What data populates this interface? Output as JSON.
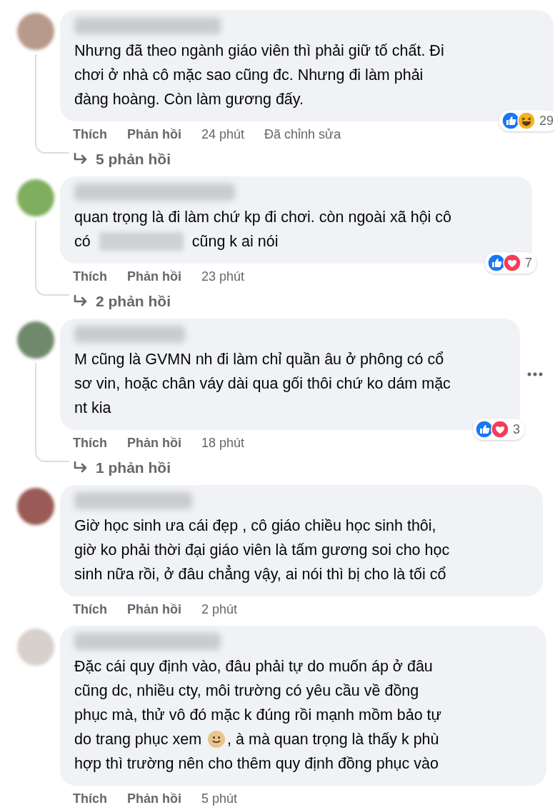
{
  "comments": [
    {
      "lines": [
        [
          {
            "kind": "text",
            "text": "Nhưng đã theo ngành giáo viên thì phải giữ tố chất. Đi"
          }
        ],
        [
          {
            "kind": "text",
            "text": "chơi ở nhà cô mặc sao cũng đc. Nhưng đi làm phải"
          }
        ],
        [
          {
            "kind": "text",
            "text": "đàng hoàng. Còn làm gương đấy."
          }
        ]
      ],
      "reactions": [
        {
          "kind": "like"
        },
        {
          "kind": "haha"
        }
      ],
      "reaction_count": "29",
      "actions": [
        "Thích",
        "Phản hồi"
      ],
      "time": "24 phút",
      "edited": "Đã chỉnh sửa",
      "replies": "5 phản hồi",
      "menu": false
    },
    {
      "lines": [
        [
          {
            "kind": "text",
            "text": "quan trọng là đi làm chứ kp đi chơi. còn ngoài xã hội cô"
          }
        ],
        [
          {
            "kind": "text",
            "text": "có"
          },
          {
            "kind": "blur"
          },
          {
            "kind": "text",
            "text": "cũng k ai nói"
          }
        ]
      ],
      "reactions": [
        {
          "kind": "like"
        },
        {
          "kind": "love"
        }
      ],
      "reaction_count": "7",
      "actions": [
        "Thích",
        "Phản hồi"
      ],
      "time": "23 phút",
      "replies": "2 phản hồi",
      "menu": false
    },
    {
      "lines": [
        [
          {
            "kind": "text",
            "text": "M cũng là GVMN nh đi làm chỉ quần âu ở phông có cổ"
          }
        ],
        [
          {
            "kind": "text",
            "text": "sơ vin, hoặc chân váy dài qua gối thôi chứ ko dám mặc"
          }
        ],
        [
          {
            "kind": "text",
            "text": "nt kia"
          }
        ]
      ],
      "reactions": [
        {
          "kind": "like"
        },
        {
          "kind": "love"
        }
      ],
      "reaction_count": "3",
      "actions": [
        "Thích",
        "Phản hồi"
      ],
      "time": "18 phút",
      "replies": "1 phản hồi",
      "menu": true
    },
    {
      "lines": [
        [
          {
            "kind": "text",
            "text": "Giờ học sinh ưa cái đẹp , cô giáo chiều học sinh thôi,"
          }
        ],
        [
          {
            "kind": "text",
            "text": "giờ ko phải thời đại giáo viên là tấm gương soi cho học"
          }
        ],
        [
          {
            "kind": "text",
            "text": "sinh nữa rồi, ở đâu chẳng vậy, ai nói thì bị cho là tối cổ"
          }
        ]
      ],
      "actions": [
        "Thích",
        "Phản hồi"
      ],
      "time": "2 phút",
      "menu": false
    },
    {
      "lines": [
        [
          {
            "kind": "text",
            "text": "Đặc cái quy định vào, đâu phải tự do muốn áp ở đâu"
          }
        ],
        [
          {
            "kind": "text",
            "text": "cũng dc, nhiều cty, môi trường có yêu cầu về đồng"
          }
        ],
        [
          {
            "kind": "text",
            "text": "phục mà, thử vô đó mặc k đúng rồi mạnh mồm bảo tự"
          }
        ],
        [
          {
            "kind": "text",
            "text": "do trang phục xem"
          },
          {
            "kind": "emoji"
          },
          {
            "kind": "text",
            "text": ", à mà quan trọng là thấy k phù"
          }
        ],
        [
          {
            "kind": "text",
            "text": "hợp thì trường nên cho thêm quy định đồng phục vào"
          }
        ]
      ],
      "actions": [
        "Thích",
        "Phản hồi"
      ],
      "time": "5 phút",
      "menu": false
    }
  ]
}
